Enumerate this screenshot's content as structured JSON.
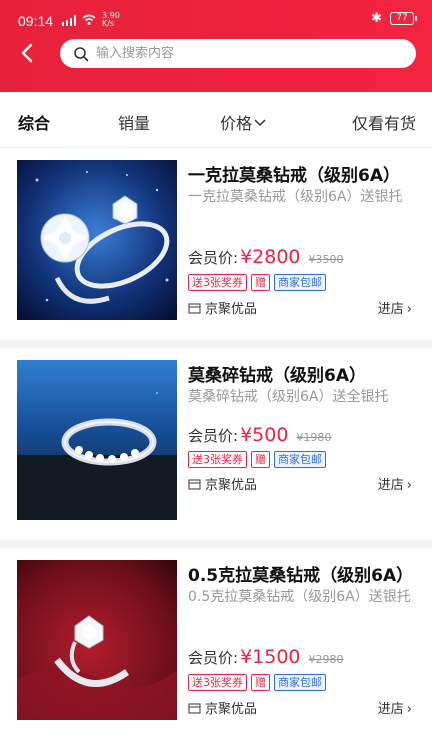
{
  "status": {
    "time": "09:14",
    "net_speed_top": "3.90",
    "net_speed_bottom": "K/s",
    "battery": "77"
  },
  "search": {
    "placeholder": "输入搜索内容"
  },
  "sort_tabs": {
    "comprehensive": "综合",
    "sales": "销量",
    "price": "价格",
    "in_stock": "仅看有货"
  },
  "products": [
    {
      "title": "一克拉莫桑钻戒（级别6A）",
      "subtitle": "一克拉莫桑钻戒（级别6A）送银托",
      "price_label": "会员价:",
      "price": "¥2800",
      "original_price": "¥3500",
      "tags": [
        "送3张奖券",
        "赠",
        "商家包邮"
      ],
      "shop": "京聚优品",
      "enter_shop": "进店"
    },
    {
      "title": "莫桑碎钻戒（级别6A）",
      "subtitle": "莫桑碎钻戒（级别6A）送全银托",
      "price_label": "会员价:",
      "price": "¥500",
      "original_price": "¥1980",
      "tags": [
        "送3张奖券",
        "赠",
        "商家包邮"
      ],
      "shop": "京聚优品",
      "enter_shop": "进店"
    },
    {
      "title": "0.5克拉莫桑钻戒（级别6A）",
      "subtitle": "0.5克拉莫桑钻戒（级别6A）送银托",
      "price_label": "会员价:",
      "price": "¥1500",
      "original_price": "¥2980",
      "tags": [
        "送3张奖券",
        "赠",
        "商家包邮"
      ],
      "shop": "京聚优品",
      "enter_shop": "进店"
    }
  ],
  "colors": {
    "brand_red": "#f2233f",
    "tag_blue": "#2f6fe0"
  }
}
